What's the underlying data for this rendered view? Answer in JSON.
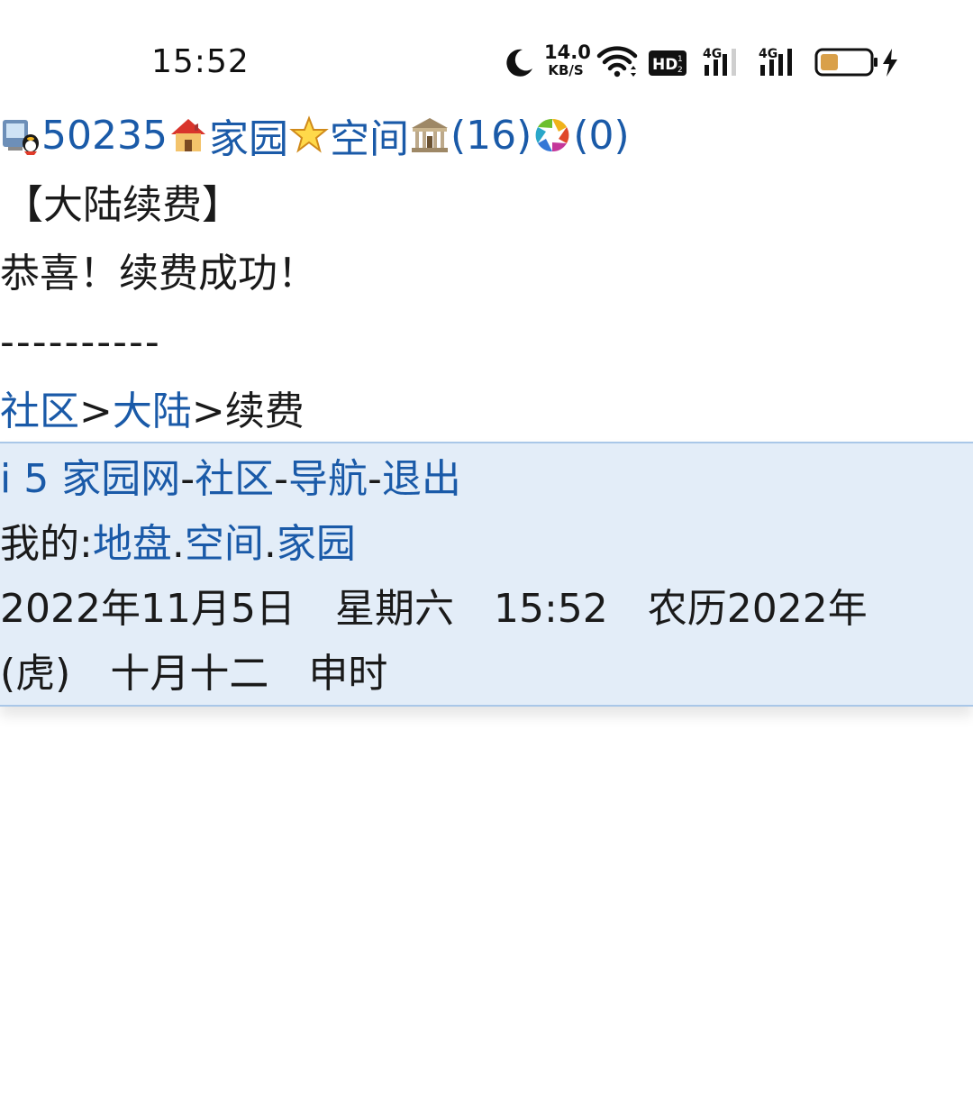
{
  "status_bar": {
    "time": "15:52",
    "net_speed_value": "14.0",
    "net_speed_unit": "KB/S",
    "hd_label": "HD",
    "signal1_label": "4G",
    "signal2_label": "4G",
    "battery_color": "#d9a04a"
  },
  "topbar": {
    "user_id": "50235",
    "home_label": "家园",
    "space_label": "空间",
    "bank_count": "(16)",
    "color_count": "(0)"
  },
  "page": {
    "heading": "【大陆续费】",
    "message": "恭喜！续费成功！",
    "separator": "----------"
  },
  "breadcrumb": {
    "community": "社区",
    "sep1": ">",
    "mainland": "大陆",
    "sep2": ">",
    "current": "续费"
  },
  "footer": {
    "site": "i 5 家园网",
    "dash1": "-",
    "community": "社区",
    "dash2": "-",
    "nav": "导航",
    "dash3": "-",
    "logout": "退出",
    "mine_label": "我的:",
    "land": "地盘",
    "dot1": ".",
    "space": "空间",
    "dot2": ".",
    "home": "家园",
    "date_line1": "2022年11月5日　星期六　15:52　农历2022年",
    "date_line2": "(虎)　十月十二　申时"
  },
  "colors": {
    "link": "#1a5aa8",
    "footer_bg": "#e3edf8",
    "footer_border": "#a9c7e8"
  }
}
